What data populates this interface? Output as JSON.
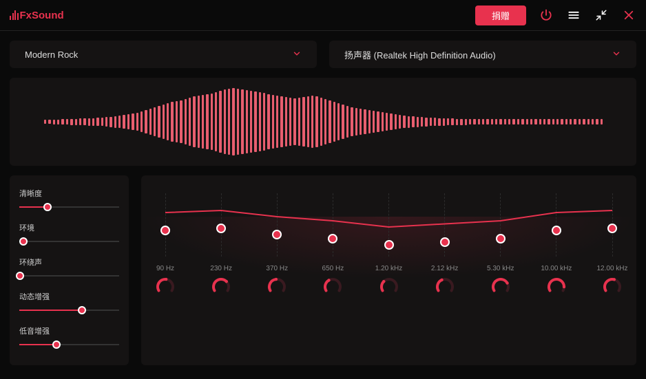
{
  "app_name": "FxSound",
  "titlebar": {
    "donate_label": "捐赠"
  },
  "dropdowns": {
    "preset": "Modern Rock",
    "output": "扬声器 (Realtek High Definition Audio)"
  },
  "sliders": [
    {
      "label": "清晰度",
      "value": 28
    },
    {
      "label": "环境",
      "value": 4
    },
    {
      "label": "环绕声",
      "value": 1
    },
    {
      "label": "动态增强",
      "value": 63
    },
    {
      "label": "低音增强",
      "value": 37
    }
  ],
  "eq": {
    "bands": [
      {
        "freq": "90 Hz",
        "gain_pct": 36,
        "knob_pct": 42
      },
      {
        "freq": "230 Hz",
        "gain_pct": 34,
        "knob_pct": 55
      },
      {
        "freq": "370 Hz",
        "gain_pct": 40,
        "knob_pct": 38
      },
      {
        "freq": "650 Hz",
        "gain_pct": 44,
        "knob_pct": 30
      },
      {
        "freq": "1.20 kHz",
        "gain_pct": 50,
        "knob_pct": 25
      },
      {
        "freq": "2.12 kHz",
        "gain_pct": 47,
        "knob_pct": 32
      },
      {
        "freq": "5.30 kHz",
        "gain_pct": 44,
        "knob_pct": 60
      },
      {
        "freq": "10.00 kHz",
        "gain_pct": 36,
        "knob_pct": 70
      },
      {
        "freq": "12.00 kHz",
        "gain_pct": 34,
        "knob_pct": 45
      }
    ]
  },
  "waveform_samples": [
    6,
    6,
    7,
    7,
    8,
    8,
    9,
    9,
    10,
    10,
    11,
    11,
    12,
    12,
    14,
    15,
    17,
    18,
    20,
    22,
    24,
    26,
    30,
    34,
    38,
    42,
    46,
    50,
    54,
    58,
    60,
    62,
    66,
    70,
    74,
    76,
    78,
    80,
    82,
    86,
    90,
    94,
    96,
    98,
    96,
    94,
    92,
    90,
    88,
    86,
    84,
    80,
    78,
    76,
    74,
    72,
    70,
    68,
    70,
    72,
    74,
    76,
    74,
    70,
    66,
    62,
    58,
    54,
    50,
    46,
    42,
    40,
    38,
    36,
    34,
    32,
    30,
    28,
    26,
    24,
    22,
    20,
    18,
    17,
    16,
    15,
    14,
    13,
    12,
    12,
    11,
    11,
    10,
    10,
    9,
    9,
    9,
    8,
    8,
    8,
    8,
    8,
    8,
    8,
    8,
    8,
    8,
    8,
    8,
    8,
    8,
    8,
    8,
    8,
    8,
    8,
    8,
    8,
    8,
    8,
    8,
    8,
    8,
    8,
    8,
    8,
    8,
    8
  ]
}
